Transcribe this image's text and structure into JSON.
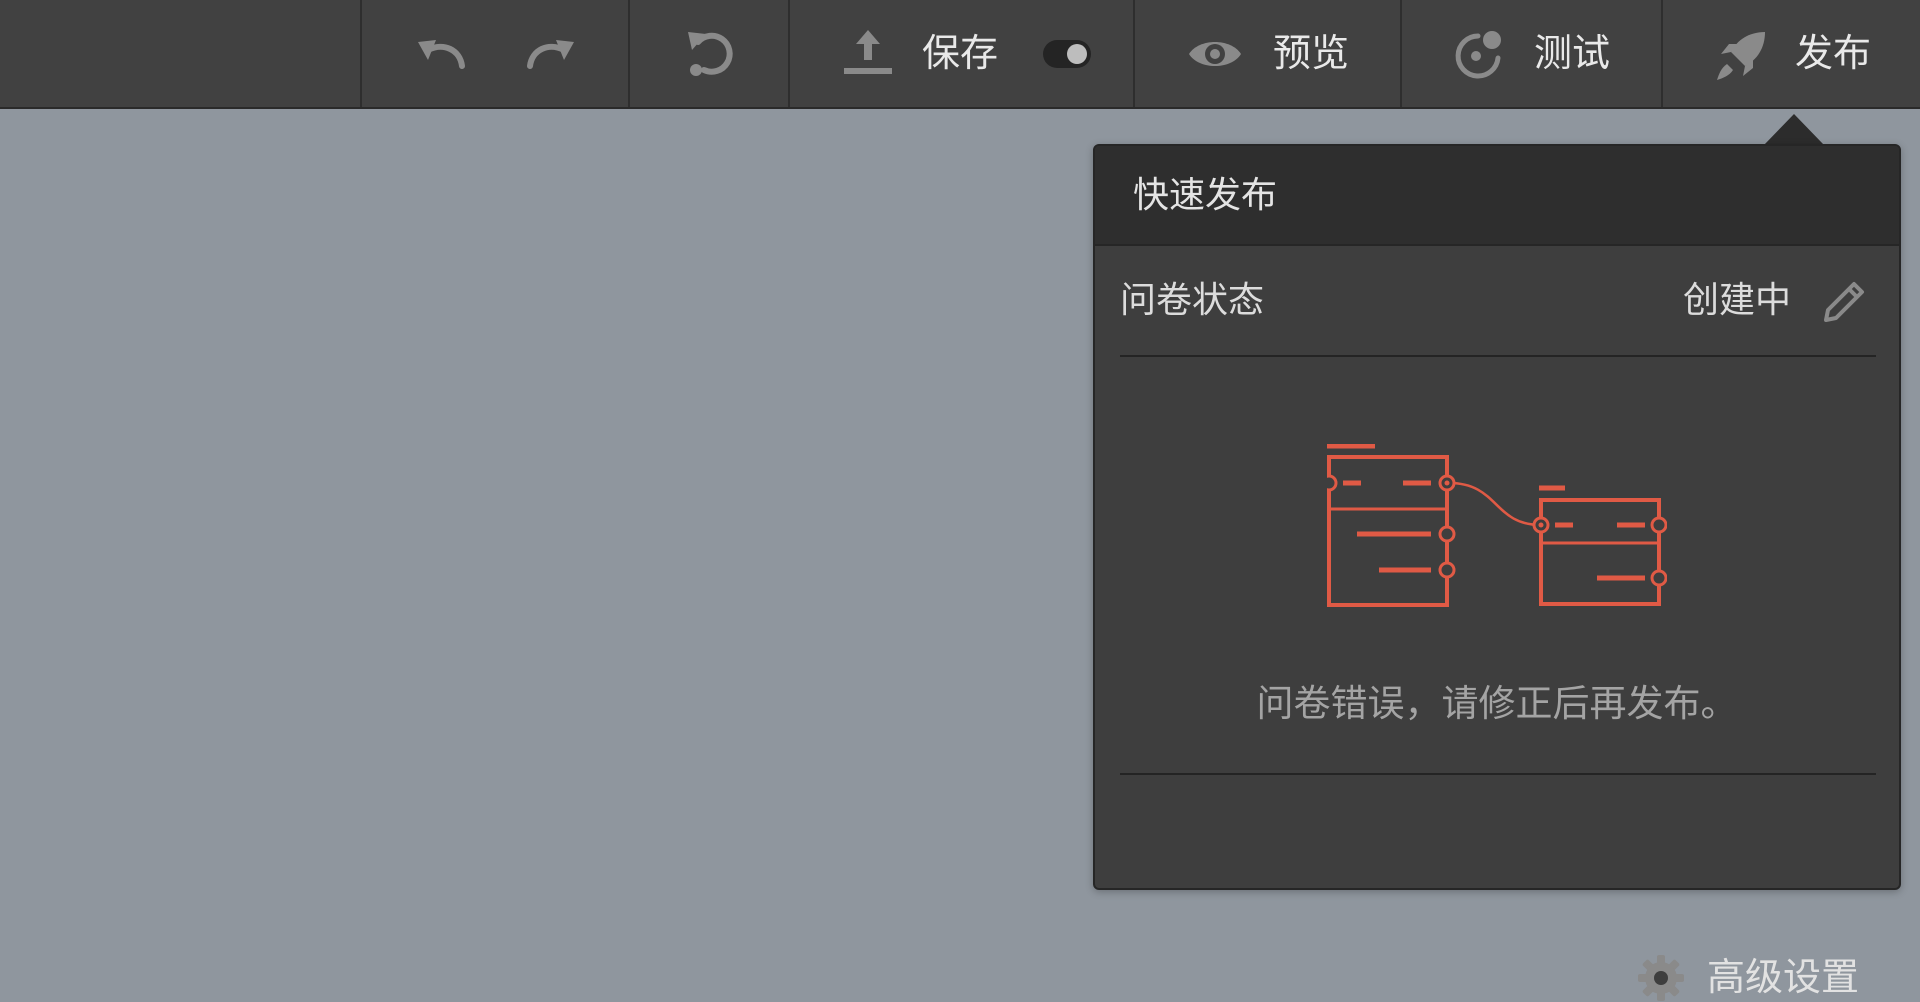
{
  "toolbar": {
    "undo_icon": "undo-icon",
    "redo_icon": "redo-icon",
    "reset_icon": "reset-icon",
    "save_label": "保存",
    "save_icon": "upload-icon",
    "autosave_toggle_on": true,
    "preview_label": "预览",
    "preview_icon": "eye-icon",
    "test_label": "测试",
    "test_icon": "test-icon",
    "publish_label": "发布",
    "publish_icon": "rocket-icon"
  },
  "popover": {
    "title": "快速发布",
    "status_label": "问卷状态",
    "status_value": "创建中",
    "edit_icon": "pencil-icon",
    "illustration": "questionnaire-flow-illustration",
    "message": "问卷错误，请修正后再发布。",
    "advanced_label": "高级设置",
    "advanced_icon": "gear-icon"
  },
  "colors": {
    "toolbar_bg": "#414141",
    "canvas_bg": "#8f969e",
    "popover_bg": "#3e3e3e",
    "popover_header_bg": "#2e2e2e",
    "illustration_accent": "#e05a45",
    "icon_gray": "#8a8a8a"
  }
}
